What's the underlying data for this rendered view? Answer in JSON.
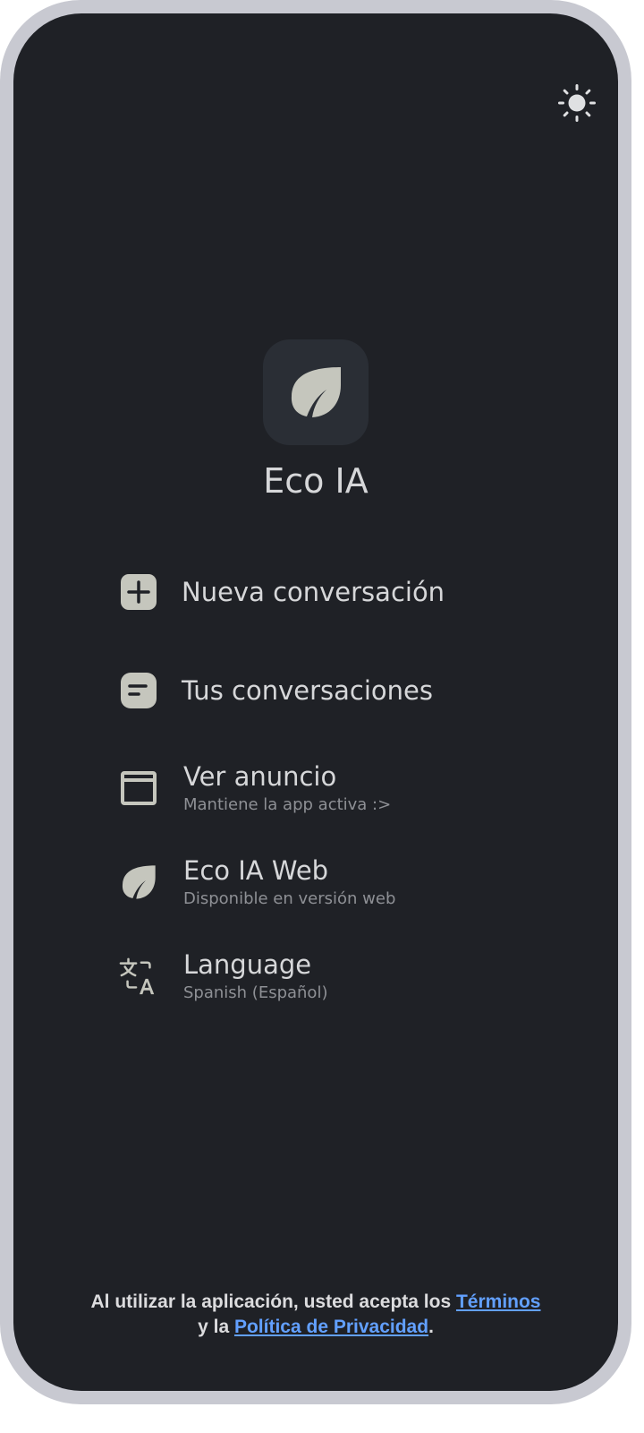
{
  "app": {
    "title": "Eco IA",
    "logo_icon": "leaf-icon"
  },
  "header": {
    "theme_toggle_icon": "sun-icon"
  },
  "menu": {
    "items": [
      {
        "label": "Nueva conversación",
        "icon": "plus-square-icon"
      },
      {
        "label": "Tus conversaciones",
        "icon": "chat-square-icon"
      },
      {
        "label": "Ver anuncio",
        "sublabel": "Mantiene la app activa :>",
        "icon": "window-icon"
      },
      {
        "label": "Eco IA Web",
        "sublabel": "Disponible en versión web",
        "icon": "leaf-icon"
      },
      {
        "label": "Language",
        "sublabel": "Spanish (Español)",
        "icon": "translate-icon"
      }
    ]
  },
  "footer": {
    "text_before": "Al utilizar la aplicación, usted acepta los ",
    "terms_link": "Términos",
    "text_middle": "y la ",
    "privacy_link": "Política de Privacidad",
    "text_end": "."
  },
  "colors": {
    "background": "#1f2126",
    "text": "#d6d7d9",
    "subtext": "#8e9095",
    "link": "#62a0ff",
    "icon": "#c5c6bd"
  }
}
